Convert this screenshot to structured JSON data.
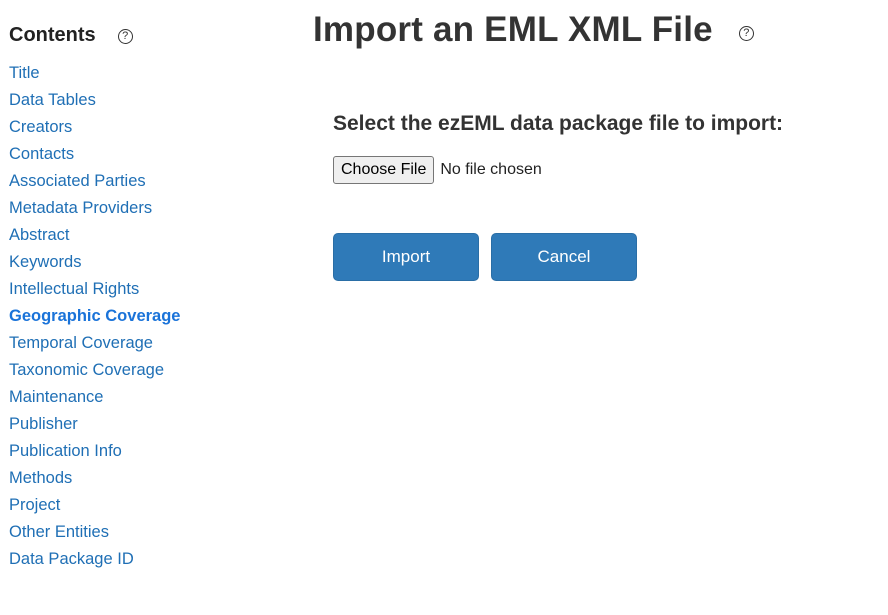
{
  "sidebar": {
    "title": "Contents",
    "help_glyph": "?",
    "items": [
      {
        "label": "Title"
      },
      {
        "label": "Data Tables"
      },
      {
        "label": "Creators"
      },
      {
        "label": "Contacts"
      },
      {
        "label": "Associated Parties"
      },
      {
        "label": "Metadata Providers"
      },
      {
        "label": "Abstract"
      },
      {
        "label": "Keywords"
      },
      {
        "label": "Intellectual Rights"
      },
      {
        "label": "Geographic Coverage",
        "active": true
      },
      {
        "label": "Temporal Coverage"
      },
      {
        "label": "Taxonomic Coverage"
      },
      {
        "label": "Maintenance"
      },
      {
        "label": "Publisher"
      },
      {
        "label": "Publication Info"
      },
      {
        "label": "Methods"
      },
      {
        "label": "Project"
      },
      {
        "label": "Other Entities"
      },
      {
        "label": "Data Package ID"
      }
    ]
  },
  "main": {
    "title": "Import an EML XML File",
    "help_glyph": "?",
    "select_label": "Select the ezEML data package file to import:",
    "file_input": {
      "button_label": "Choose File",
      "status": "No file chosen"
    },
    "import_label": "Import",
    "cancel_label": "Cancel"
  },
  "icons": {
    "contents_help": "help-circle-icon",
    "title_help": "help-circle-icon"
  },
  "colors": {
    "link": "#1f6fb5",
    "active_link": "#1a73d9",
    "primary_button": "#2f7ab8",
    "text": "#333333"
  }
}
